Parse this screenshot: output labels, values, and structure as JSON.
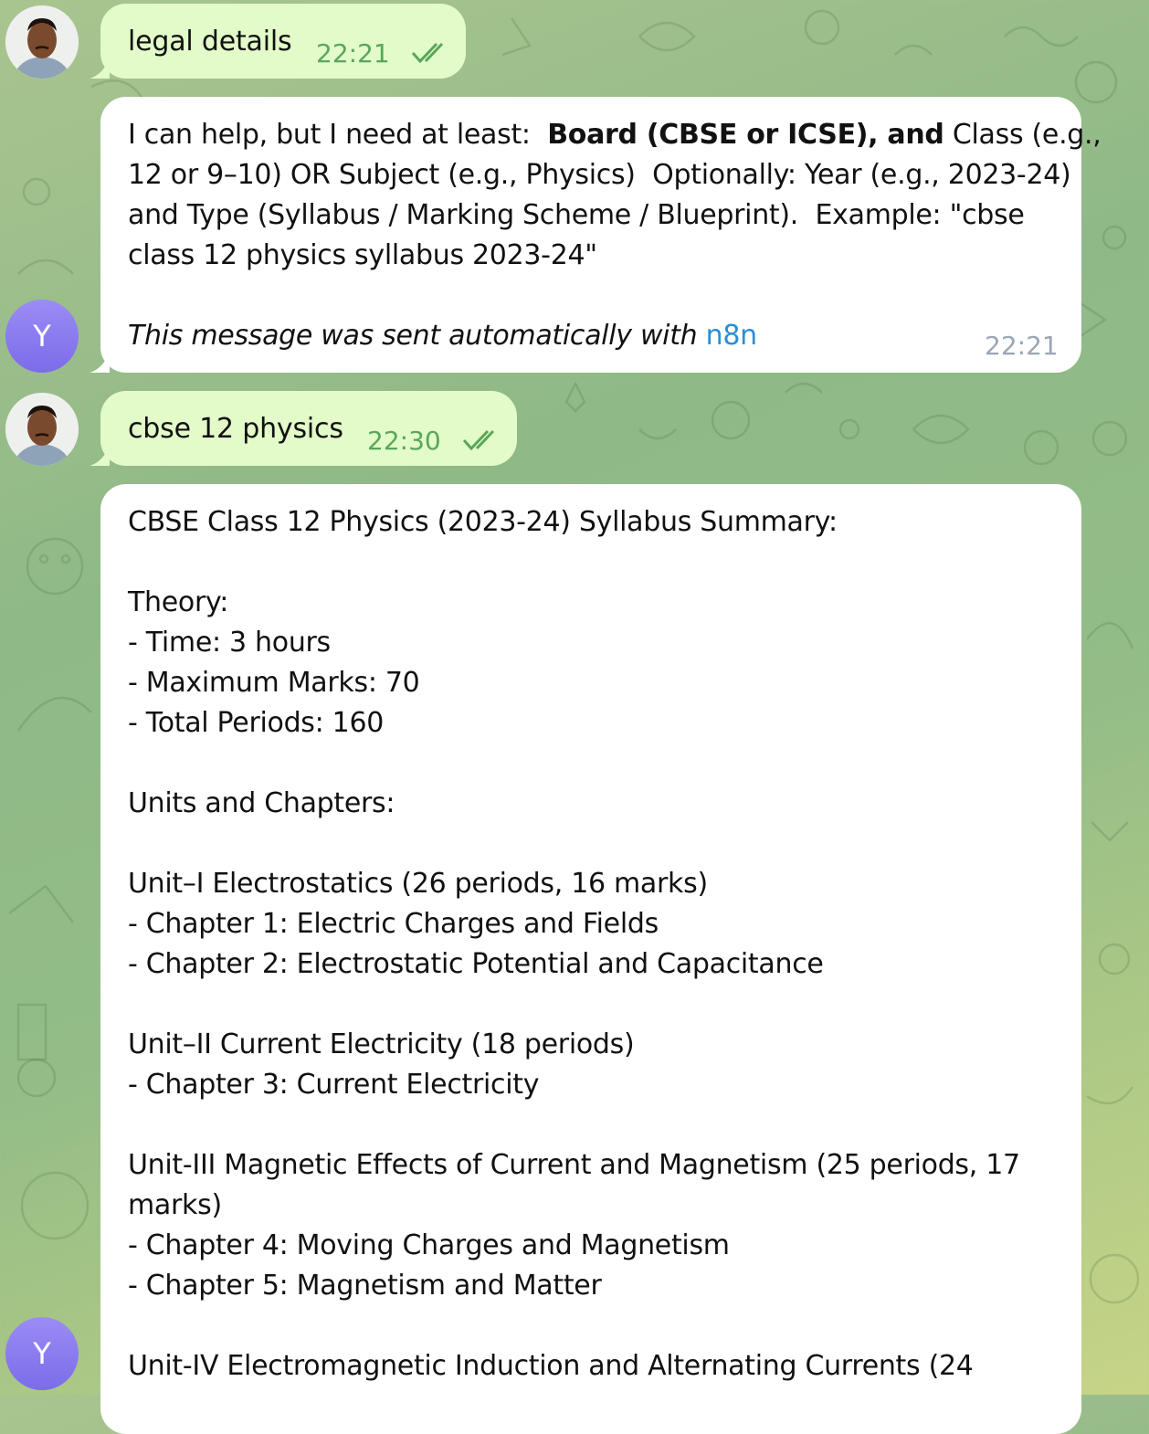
{
  "chat": {
    "messages": [
      {
        "direction": "outgoing",
        "text": "legal details",
        "time": "22:21",
        "status": "read"
      },
      {
        "direction": "incoming",
        "avatar_letter": "Y",
        "text_before_bold": "I can help, but I need at least:  ",
        "text_bold": "Board (CBSE or ICSE), and",
        "lines": [
          " Class (e.g.,",
          "12 or 9–10) OR Subject (e.g., Physics)  Optionally: Year (e.g., 2023-24)",
          "and Type (Syllabus / Marking Scheme / Blueprint).  Example: \"cbse",
          "class 12 physics syllabus 2023-24\""
        ],
        "footer_prefix": "This message was sent automatically with ",
        "footer_link": "n8n",
        "time": "22:21"
      },
      {
        "direction": "outgoing",
        "text": "cbse 12 physics",
        "time": "22:30",
        "status": "read"
      },
      {
        "direction": "incoming",
        "avatar_letter": "Y",
        "lines": [
          "CBSE Class 12 Physics (2023-24) Syllabus Summary:",
          "",
          "Theory:",
          "- Time: 3 hours",
          "- Maximum Marks: 70",
          "- Total Periods: 160",
          "",
          "Units and Chapters:",
          "",
          "Unit–I Electrostatics (26 periods, 16 marks)",
          "- Chapter 1: Electric Charges and Fields",
          "- Chapter 2: Electrostatic Potential and Capacitance",
          "",
          "Unit–II Current Electricity (18 periods)",
          "- Chapter 3: Current Electricity",
          "",
          "Unit-III Magnetic Effects of Current and Magnetism (25 periods, 17",
          "marks)",
          "- Chapter 4: Moving Charges and Magnetism",
          "- Chapter 5: Magnetism and Matter",
          "",
          "Unit-IV Electromagnetic Induction and Alternating Currents (24"
        ]
      }
    ]
  },
  "colors": {
    "outgoing_bubble": "#e2fbc9",
    "incoming_bubble": "#ffffff",
    "outgoing_time": "#5aa65a",
    "incoming_time": "#9aa6b4",
    "link": "#2a8fd3",
    "bot_avatar": "#8b7cf0"
  },
  "icons": {
    "read_status": "double-check-icon",
    "user_avatar": "user-photo-avatar",
    "bot_avatar": "letter-avatar"
  }
}
